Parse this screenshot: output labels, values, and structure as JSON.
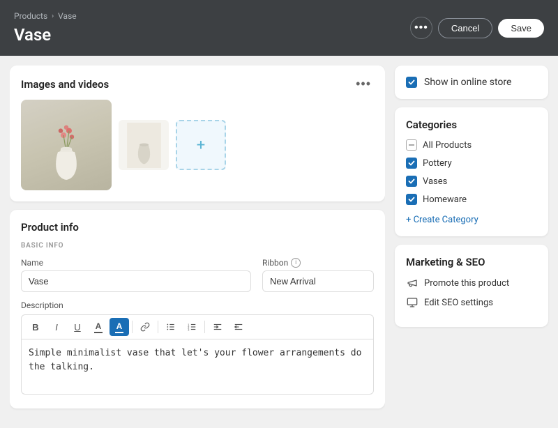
{
  "breadcrumb": {
    "parent": "Products",
    "current": "Vase",
    "separator": "›"
  },
  "page": {
    "title": "Vase"
  },
  "header": {
    "dots_label": "•••",
    "cancel_label": "Cancel",
    "save_label": "Save"
  },
  "images_section": {
    "title": "Images and videos",
    "more_icon": "•••",
    "add_label": "+"
  },
  "product_info": {
    "title": "Product info",
    "basic_info_label": "BASIC INFO",
    "name_label": "Name",
    "name_value": "Vase",
    "ribbon_label": "Ribbon",
    "ribbon_info": "i",
    "ribbon_value": "New Arrival",
    "description_label": "Description",
    "description_value": "Simple minimalist vase that let's your flower arrangements do the talking.",
    "toolbar": {
      "bold": "B",
      "italic": "I",
      "underline": "U",
      "text_color": "A",
      "highlight": "A",
      "link": "⛓",
      "bullet_list": "≡",
      "ordered_list": "≡",
      "indent": "⇥",
      "outdent": "⇤"
    }
  },
  "sidebar": {
    "online_store": {
      "label": "Show in online store",
      "checked": true
    },
    "categories": {
      "title": "Categories",
      "items": [
        {
          "label": "All Products",
          "checked": "partial"
        },
        {
          "label": "Pottery",
          "checked": true
        },
        {
          "label": "Vases",
          "checked": true
        },
        {
          "label": "Homeware",
          "checked": true
        }
      ],
      "create_label": "+ Create Category"
    },
    "marketing": {
      "title": "Marketing & SEO",
      "items": [
        {
          "label": "Promote this product",
          "icon": "megaphone"
        },
        {
          "label": "Edit SEO settings",
          "icon": "settings"
        }
      ]
    }
  }
}
